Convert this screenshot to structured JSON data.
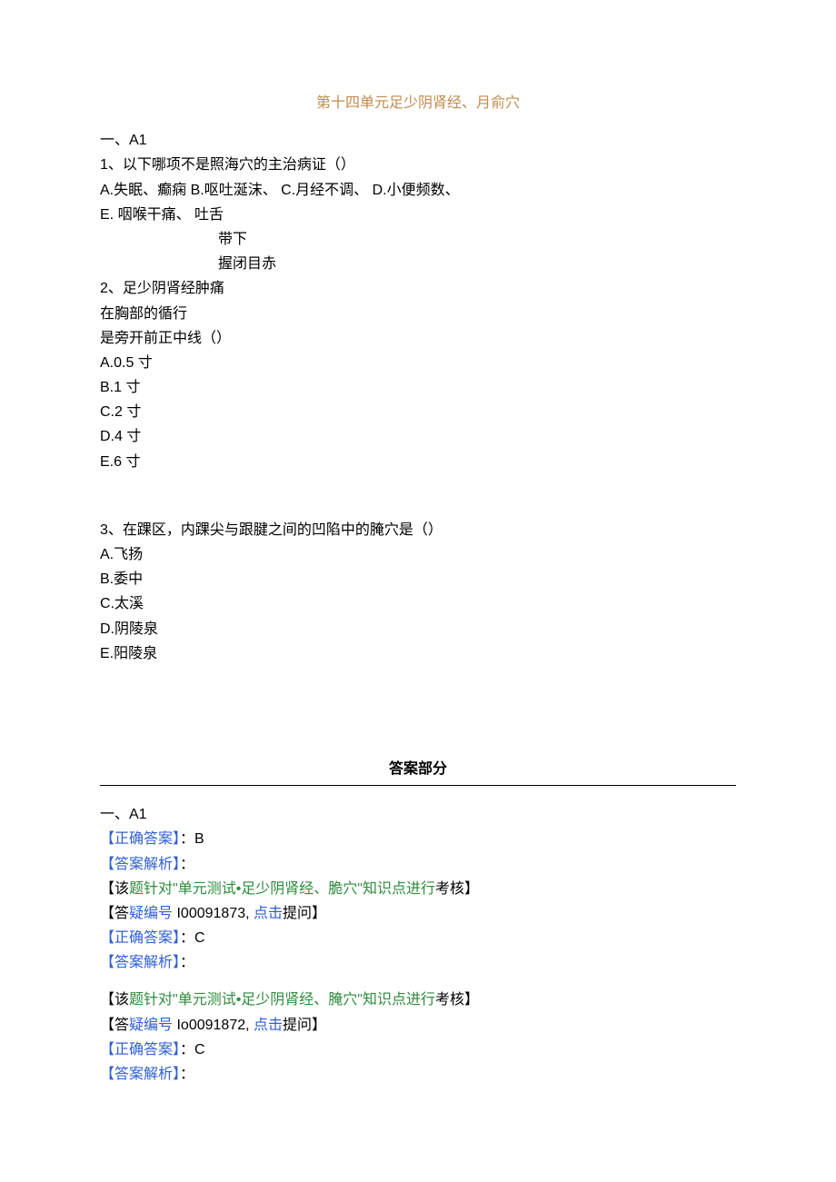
{
  "title": "第十四单元足少阴肾经、月俞穴",
  "section1_label": "一、A1",
  "q1": {
    "stem": "1、以下哪项不是照海穴的主治病证（）",
    "line1_a": "A.失眠、癫痫",
    "line1_b": "B.呕吐涎沫、",
    "line1_c": "C.月经不调、",
    "line1_d": "D.小便频数、",
    "line2": "E. 咽喉干痛、 吐舌",
    "line3": "带下",
    "line4": "握闭目赤"
  },
  "q2": {
    "stem_l1": "2、足少阴肾经肿痛",
    "stem_l2": "在胸部的循行",
    "stem_l3": "是旁开前正中线（）",
    "opts": {
      "a": "A.0.5 寸",
      "b": "B.1 寸",
      "c": "C.2 寸",
      "d": "D.4 寸",
      "e": "E.6 寸"
    }
  },
  "q3": {
    "stem": "3、在踝区，内踝尖与跟腱之间的凹陷中的腌穴是（）",
    "opts": {
      "a": "A.飞扬",
      "b": "B.委中",
      "c": "C.太溪",
      "d": "D.阴陵泉",
      "e": "E.阳陵泉"
    }
  },
  "answers_header": "答案部分",
  "ans_section_label": "一、A1",
  "labels": {
    "correct": "【正确答案】",
    "explain": "【答案解析】",
    "colon": "："
  },
  "ans1": {
    "value": "B",
    "knowl_pre": "【该",
    "knowl_green": "题针对\"单元测试•足少阴肾经、脆穴\"知识点进行",
    "knowl_suf": "考核】",
    "faq_pre": "【答",
    "faq_mid1": "疑编号",
    "faq_id": " I00091873, ",
    "faq_click": "点击",
    "faq_suf": "提问】"
  },
  "ans2": {
    "value": "C",
    "knowl_pre": "【该",
    "knowl_green": "题针对\"单元测试•足少阴肾经、腌穴\"知识点进行",
    "knowl_suf": "考核】",
    "faq_pre": "【答",
    "faq_mid1": "疑编号",
    "faq_id": " Io0091872, ",
    "faq_click": "点击",
    "faq_suf": "提问】"
  },
  "ans3": {
    "value": "C"
  }
}
